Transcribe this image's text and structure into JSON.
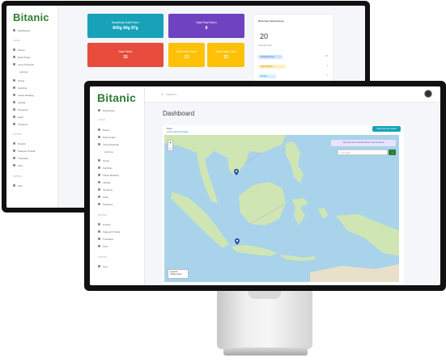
{
  "back_monitor": {
    "logo": "Bitanic",
    "sidebar": {
      "items_top": [
        "Dashboard"
      ],
      "section_1": "Lahan",
      "items_1": [
        "Petani",
        "Data Petani",
        "Jenis Tanaman",
        "Lainnya",
        "Hama",
        "Fertilizer",
        "Lahan Bawang",
        "Jadwal",
        "Tanaman",
        "Hasil",
        "Telegram"
      ],
      "section_2": "Master",
      "items_2": [
        "Produk",
        "Kategori Produk",
        "Transaksi",
        "Toko"
      ],
      "section_3": "Setting",
      "items_3": [
        "User"
      ]
    },
    "cards": {
      "teal_label": "Banyaknya Data Panen",
      "teal_value": "843g 84g 87g",
      "purple_label": "Data Pasa Panen",
      "purple_value": "8",
      "red_label": "Data Panen",
      "red_value": "15",
      "yellow1_label": "Data Jenis Panen",
      "yellow1_value": "23",
      "yellow2_label": "Data Panen Hasil",
      "yellow2_value": "23"
    },
    "side_panel": {
      "title": "Data Hari Sebelumnya",
      "number": "20",
      "subtitle": "Data Berhasil",
      "pills": [
        "Berhasil Bertani",
        "Telur Perkutut",
        "Bertani"
      ],
      "pill_counts": [
        "10",
        "1",
        "1"
      ]
    }
  },
  "front_monitor": {
    "logo": "Bitanic",
    "search_placeholder": "Search...",
    "page_title": "Dashboard",
    "sidebar": {
      "items_top": [
        "Dashboard"
      ],
      "section_1": "Lahan",
      "items_1": [
        "Petani",
        "Data Petani",
        "Jenis Tanaman",
        "Lainnya",
        "Hama",
        "Fertilizer",
        "Lahan Bawang",
        "Jadwal",
        "Tanaman",
        "Hasil",
        "Telegram"
      ],
      "section_2": "Master",
      "items_2": [
        "Produk",
        "Kategori Produk",
        "Transaksi",
        "Toko"
      ],
      "section_3": "Setting",
      "items_3": [
        "User"
      ]
    },
    "map_card": {
      "title": "Peta",
      "subtitle": "Lihat Lokasi Perangkat",
      "button": "Lihat Semua Lahan",
      "coord_text": "Klik peta untuk melihat latitude dan longitude",
      "input_placeholder": "Cari lokasi",
      "go_button": "→",
      "zoom_in": "+",
      "zoom_out": "−",
      "legend_title": "Legenda",
      "legend_item": "Lokasi Lahan"
    }
  },
  "colors": {
    "brand_green": "#2e7d32",
    "teal": "#17a2b8",
    "purple": "#6f42c1",
    "red": "#e74c3c",
    "yellow": "#ffc107",
    "sea": "#a9d3ea",
    "land": "#cfe6b4"
  }
}
